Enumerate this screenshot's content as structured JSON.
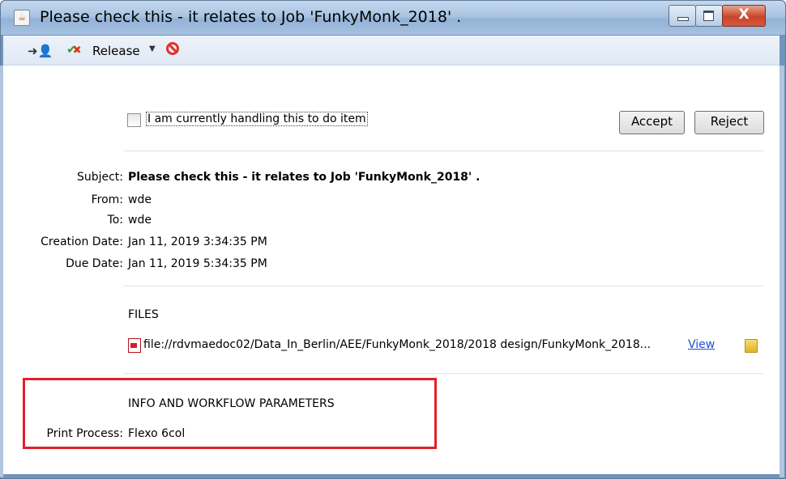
{
  "window": {
    "title": "Please check this - it relates to Job 'FunkyMonk_2018' .",
    "close_glyph": "X"
  },
  "toolbar": {
    "release_label": "Release"
  },
  "handling": {
    "checkbox_label": "I am currently handling this to do item",
    "checked": false
  },
  "actions": {
    "accept_label": "Accept",
    "reject_label": "Reject"
  },
  "details": {
    "subject_label": "Subject:",
    "subject_value": "Please check this - it relates to Job 'FunkyMonk_2018' .",
    "from_label": "From:",
    "from_value": "wde",
    "to_label": "To:",
    "to_value": "wde",
    "creation_label": "Creation Date:",
    "creation_value": "Jan 11, 2019 3:34:35 PM",
    "due_label": "Due Date:",
    "due_value": "Jan 11, 2019 5:34:35 PM"
  },
  "files": {
    "heading": "FILES",
    "items": [
      {
        "path": "file://rdvmaedoc02/Data_In_Berlin/AEE/FunkyMonk_2018/2018 design/FunkyMonk_2018...",
        "view_label": "View"
      }
    ]
  },
  "info": {
    "heading": "INFO AND WORKFLOW PARAMETERS",
    "print_process_label": "Print Process:",
    "print_process_value": "Flexo 6col"
  },
  "colors": {
    "highlight": "#e0202b",
    "link": "#1d4fd1",
    "titlebar": "#a9c4e2"
  }
}
